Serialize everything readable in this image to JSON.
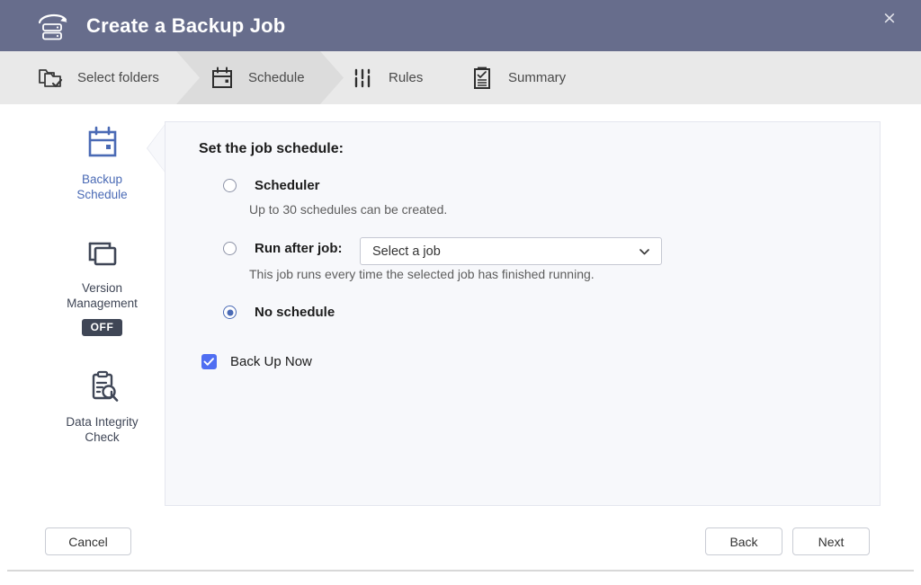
{
  "window": {
    "title": "Create a Backup Job",
    "title_icon": "backup-server-icon",
    "close_label": "×",
    "header_color": "#676d8c"
  },
  "stepper": {
    "steps": [
      {
        "label": "Select folders",
        "icon": "folder-check-icon",
        "active": false
      },
      {
        "label": "Schedule",
        "icon": "calendar-icon",
        "active": true
      },
      {
        "label": "Rules",
        "icon": "sliders-icon",
        "active": false
      },
      {
        "label": "Summary",
        "icon": "clipboard-check-icon",
        "active": false
      }
    ]
  },
  "sidebar": {
    "items": [
      {
        "label": "Backup\nSchedule",
        "line1": "Backup",
        "line2": "Schedule",
        "icon": "calendar-icon",
        "active": true,
        "badge": null
      },
      {
        "label": "Version Management",
        "line1": "Version",
        "line2": "Management",
        "icon": "layers-window-icon",
        "active": false,
        "badge": "OFF"
      },
      {
        "label": "Data Integrity Check",
        "line1": "Data Integrity",
        "line2": "Check",
        "icon": "clipboard-search-icon",
        "active": false,
        "badge": null
      }
    ],
    "active_color": "#4a6ab5",
    "inactive_color": "#3f4656"
  },
  "panel": {
    "title": "Set the job schedule:",
    "options": [
      {
        "label": "Scheduler",
        "selected": false,
        "hint": "Up to 30 schedules can be created."
      },
      {
        "label": "Run after job:",
        "selected": false,
        "hint": "This job runs every time the selected job has finished running."
      },
      {
        "label": "No schedule",
        "selected": true,
        "hint": null
      }
    ],
    "job_select": {
      "value": "Select a job",
      "placeholder": "Select a job",
      "options": [
        "Select a job"
      ]
    },
    "backup_now": {
      "label": "Back Up Now",
      "checked": true,
      "accent": "#4f6ef2"
    }
  },
  "footer": {
    "cancel": "Cancel",
    "back": "Back",
    "next": "Next"
  }
}
